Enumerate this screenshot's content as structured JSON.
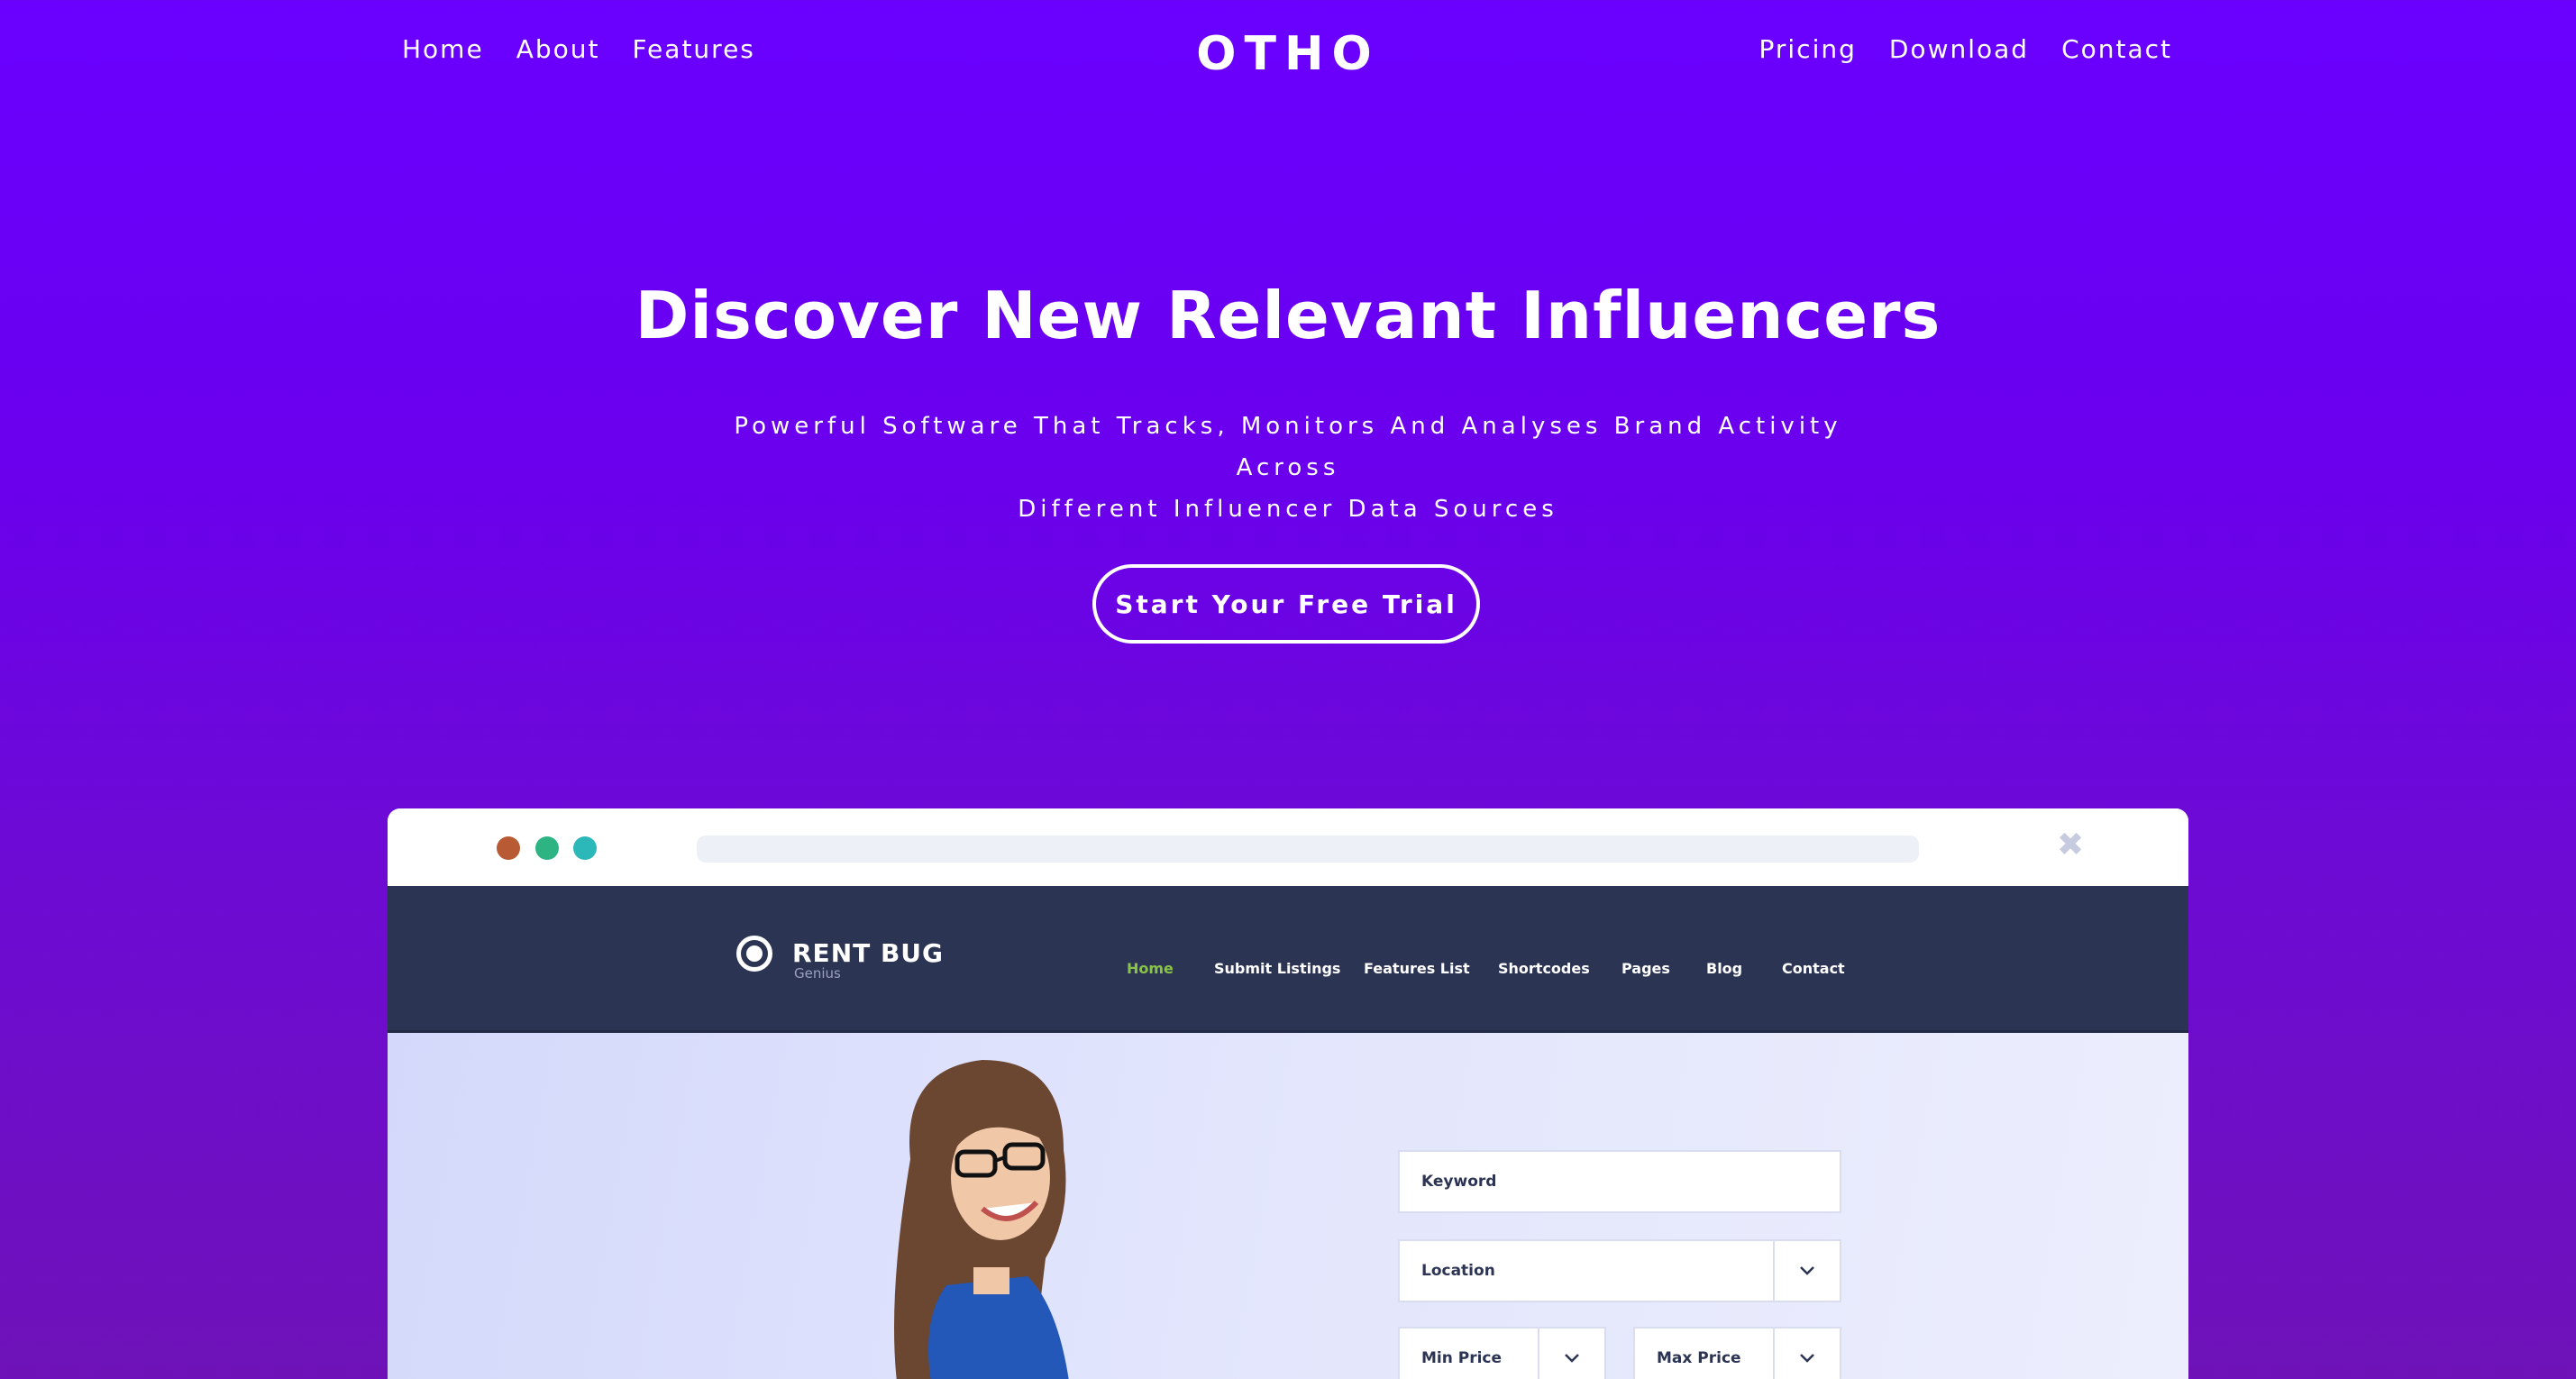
{
  "nav": {
    "left": [
      "Home",
      "About",
      "Features"
    ],
    "right": [
      "Pricing",
      "Download",
      "Contact"
    ],
    "brand": "OTHO"
  },
  "hero": {
    "title": "Discover New Relevant Influencers",
    "subtitle_line1": "Powerful Software That Tracks, Monitors And Analyses Brand Activity Across",
    "subtitle_line2": "Different Influencer Data Sources",
    "cta": "Start Your Free Trial"
  },
  "mockup": {
    "window_dots": [
      "#b85a33",
      "#2eb383",
      "#2cb8b8"
    ],
    "close_icon": "close-icon",
    "site": {
      "name": "RENT BUG",
      "tagline": "Genius",
      "menu": [
        "Home",
        "Submit Listings",
        "Features List",
        "Shortcodes",
        "Pages",
        "Blog",
        "Contact"
      ],
      "menu_active_color": "#8ac24a",
      "search": {
        "keyword": "Keyword",
        "location": "Location",
        "min_price": "Min Price",
        "max_price": "Max Price"
      }
    }
  },
  "colors": {
    "background_top": "#6a00ff",
    "background_bottom": "#6e12b8",
    "site_header": "#2c3454"
  }
}
